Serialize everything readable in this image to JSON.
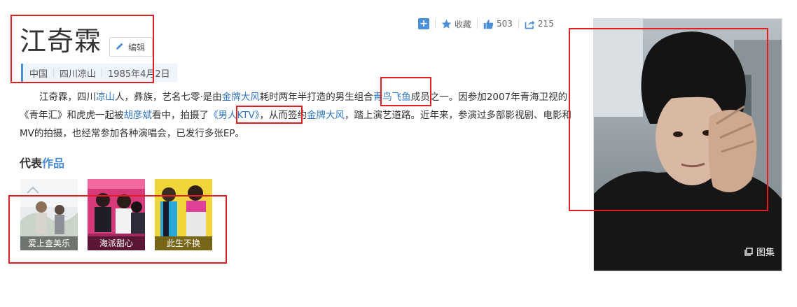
{
  "person": {
    "name": "江奇霖",
    "edit_label": "编辑",
    "meta": [
      "中国",
      "四川凉山",
      "1985年4月2日"
    ]
  },
  "actions": {
    "favorite_label": "收藏",
    "like_count": "503",
    "share_count": "215"
  },
  "summary": {
    "s1": "江奇霖，四川",
    "l1": "凉山",
    "s2": "人，彝族，艺名七零·是由",
    "l2": "金牌大风",
    "s3": "耗时两年半打造的男生组合",
    "l3": "青鸟飞鱼",
    "s4": "成员之一。因参加2007年青海卫视的《青年汇》和虎虎一起被",
    "l4": "胡彦斌",
    "s5": "看中，拍摄了",
    "l5": "《男人KTV》",
    "s6": "，从而签约",
    "l6": "金牌大风",
    "s7": "，踏上演艺道路。近年来，参演过多部影视剧、电影和MV的拍摄，也经常参加各种演唱会，已发行多张EP。"
  },
  "works": {
    "title_plain": "代表",
    "title_accent": "作品",
    "items": [
      {
        "caption": "爱上查美乐"
      },
      {
        "caption": "海派甜心"
      },
      {
        "caption": "此生不换"
      }
    ]
  },
  "photo": {
    "gallery_label": "图集"
  },
  "colors": {
    "link": "#2f75c0",
    "accent": "#4a90d9",
    "highlight": "#e02020"
  }
}
